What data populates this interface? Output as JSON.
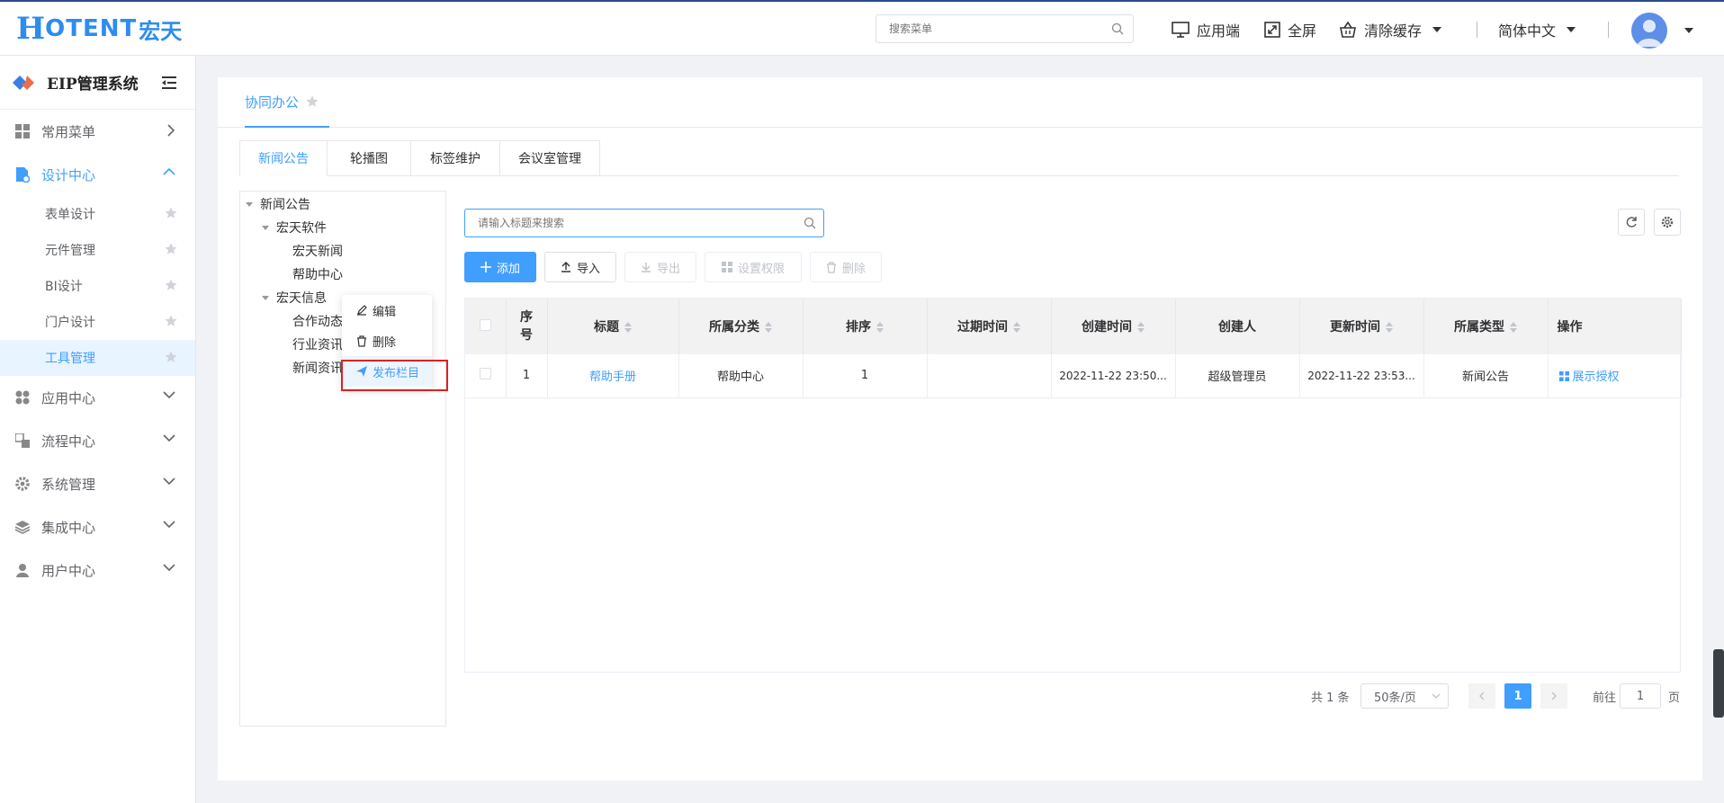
{
  "header": {
    "logo_h": "H",
    "logo_text": "OTENT",
    "logo_cn": "宏天",
    "search_placeholder": "搜索菜单",
    "app_label": "应用端",
    "fullscreen_label": "全屏",
    "clear_cache_label": "清除缓存",
    "language_label": "简体中文"
  },
  "sidebar": {
    "system_title": "EIP管理系统",
    "menus": [
      {
        "label": "常用菜单",
        "icon": "grid-icon"
      },
      {
        "label": "设计中心",
        "icon": "design-icon"
      },
      {
        "label": "应用中心",
        "icon": "apps-icon"
      },
      {
        "label": "流程中心",
        "icon": "flow-icon"
      },
      {
        "label": "系统管理",
        "icon": "gear-icon"
      },
      {
        "label": "集成中心",
        "icon": "layers-icon"
      },
      {
        "label": "用户中心",
        "icon": "user-icon"
      }
    ],
    "sub_items": [
      "表单设计",
      "元件管理",
      "BI设计",
      "门户设计",
      "工具管理"
    ]
  },
  "page": {
    "tab_label": "协同办公",
    "sub_tabs": [
      "新闻公告",
      "轮播图",
      "标签维护",
      "会议室管理"
    ]
  },
  "tree": {
    "root": "新闻公告",
    "nodes": [
      "宏天软件",
      "宏天新闻",
      "帮助中心",
      "宏天信息",
      "合作动态",
      "行业资讯",
      "新闻资讯"
    ]
  },
  "context_menu": {
    "edit": "编辑",
    "delete": "删除",
    "publish": "发布栏目"
  },
  "toolbar": {
    "search_placeholder": "请输入标题来搜索",
    "add": "添加",
    "import": "导入",
    "export": "导出",
    "permissions": "设置权限",
    "delete": "删除"
  },
  "table": {
    "headers": [
      "序号",
      "标题",
      "所属分类",
      "排序",
      "过期时间",
      "创建时间",
      "创建人",
      "更新时间",
      "所属类型",
      "操作"
    ],
    "rows": [
      {
        "index": "1",
        "title": "帮助手册",
        "category": "帮助中心",
        "order": "1",
        "expire": "",
        "created": "2022-11-22 23:50...",
        "creator": "超级管理员",
        "updated": "2022-11-22 23:53...",
        "type": "新闻公告",
        "action": "展示授权"
      }
    ]
  },
  "pagination": {
    "total": "共 1 条",
    "page_size": "50条/页",
    "current": "1",
    "goto_label": "前往",
    "goto_value": "1",
    "page_suffix": "页"
  },
  "colors": {
    "primary": "#409eff",
    "highlight_box": "#e02020"
  }
}
